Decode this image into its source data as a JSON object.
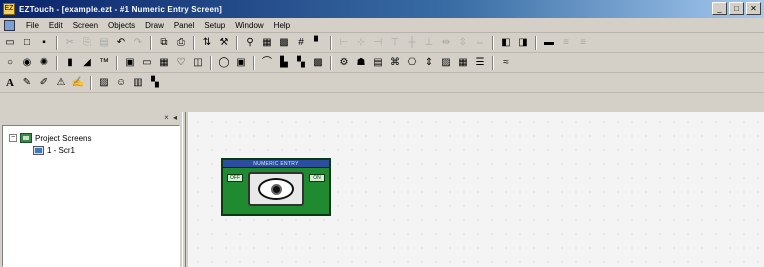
{
  "window": {
    "app_icon_glyph": "EZ",
    "title": "EZTouch - [example.ezt - #1 Numeric Entry Screen]",
    "min_glyph": "_",
    "max_glyph": "□",
    "close_glyph": "✕"
  },
  "menu": {
    "items": [
      "File",
      "Edit",
      "Screen",
      "Objects",
      "Draw",
      "Panel",
      "Setup",
      "Window",
      "Help"
    ]
  },
  "toolbar1": [
    {
      "icon": "new-file-icon",
      "glyph": "▭"
    },
    {
      "icon": "new-doc-icon",
      "glyph": "□"
    },
    {
      "icon": "save-icon",
      "glyph": "▪"
    },
    {
      "sep": true
    },
    {
      "icon": "cut-icon",
      "glyph": "✂",
      "dim": true
    },
    {
      "icon": "copy-icon",
      "glyph": "⎘",
      "dim": true
    },
    {
      "icon": "paste-icon",
      "glyph": "▤",
      "dim": true
    },
    {
      "icon": "undo-icon",
      "glyph": "↶"
    },
    {
      "icon": "redo-icon",
      "glyph": "↷",
      "dim": true
    },
    {
      "sep": true
    },
    {
      "icon": "copy-screen-icon",
      "glyph": "⧉"
    },
    {
      "icon": "print-icon",
      "glyph": "⎙"
    },
    {
      "sep": true
    },
    {
      "icon": "transfer-icon",
      "glyph": "⇅"
    },
    {
      "icon": "tools-icon",
      "glyph": "⚒"
    },
    {
      "sep": true
    },
    {
      "icon": "zoom-icon",
      "glyph": "⚲"
    },
    {
      "icon": "grid-icon",
      "glyph": "▦"
    },
    {
      "icon": "grid-fine-icon",
      "glyph": "▩"
    },
    {
      "icon": "snap-icon",
      "glyph": "#"
    },
    {
      "icon": "flag-icon",
      "glyph": "▘"
    },
    {
      "sep": true
    },
    {
      "icon": "align-left-icon",
      "glyph": "⊢",
      "dim": true
    },
    {
      "icon": "align-center-icon",
      "glyph": "⊹",
      "dim": true
    },
    {
      "icon": "align-right-icon",
      "glyph": "⊣",
      "dim": true
    },
    {
      "icon": "align-top-icon",
      "glyph": "⊤",
      "dim": true
    },
    {
      "icon": "align-middle-icon",
      "glyph": "┼",
      "dim": true
    },
    {
      "icon": "align-bottom-icon",
      "glyph": "⊥",
      "dim": true
    },
    {
      "icon": "space-h-icon",
      "glyph": "⇹",
      "dim": true
    },
    {
      "icon": "space-v-icon",
      "glyph": "⇳",
      "dim": true
    },
    {
      "icon": "same-size-icon",
      "glyph": "⇔",
      "dim": true
    },
    {
      "sep": true
    },
    {
      "icon": "bring-front-icon",
      "glyph": "◧"
    },
    {
      "icon": "send-back-icon",
      "glyph": "◨"
    },
    {
      "sep": true
    },
    {
      "icon": "panel-icon",
      "glyph": "▬"
    },
    {
      "icon": "more1-icon",
      "glyph": "≡",
      "dim": true
    },
    {
      "icon": "more2-icon",
      "glyph": "≡",
      "dim": true
    }
  ],
  "toolbar2": [
    {
      "icon": "circle-icon",
      "glyph": "○"
    },
    {
      "icon": "lamp-icon",
      "glyph": "◉"
    },
    {
      "icon": "pilot-light-icon",
      "glyph": "✺"
    },
    {
      "sep": true
    },
    {
      "icon": "bargraph-icon",
      "glyph": "▮"
    },
    {
      "icon": "meter-icon",
      "glyph": "◢"
    },
    {
      "icon": "tm-icon",
      "glyph": "™"
    },
    {
      "sep": true
    },
    {
      "icon": "numeric-display-icon",
      "glyph": "▣"
    },
    {
      "icon": "numeric-entry-icon",
      "glyph": "▭"
    },
    {
      "icon": "keypad-icon",
      "glyph": "▦"
    },
    {
      "icon": "indicator-icon",
      "glyph": "♡"
    },
    {
      "icon": "selector-icon",
      "glyph": "◫"
    },
    {
      "sep": true
    },
    {
      "icon": "ellipse-button-icon",
      "glyph": "◯"
    },
    {
      "icon": "pushbutton-icon",
      "glyph": "▣"
    },
    {
      "sep": true
    },
    {
      "icon": "arc-icon",
      "glyph": "⌒"
    },
    {
      "icon": "chart-icon",
      "glyph": "▙"
    },
    {
      "icon": "trend-icon",
      "glyph": "▚"
    },
    {
      "icon": "bitmap-icon",
      "glyph": "▩"
    },
    {
      "sep": true
    },
    {
      "icon": "thumbwheel-icon",
      "glyph": "⚙"
    },
    {
      "icon": "alarm-icon",
      "glyph": "☗"
    },
    {
      "icon": "recipe-icon",
      "glyph": "▤"
    },
    {
      "icon": "switch-icon",
      "glyph": "⌘"
    },
    {
      "icon": "goto-screen-icon",
      "glyph": "⎔"
    },
    {
      "icon": "slider-icon",
      "glyph": "⇕"
    },
    {
      "icon": "message-icon",
      "glyph": "▨"
    },
    {
      "icon": "bitmap-button-icon",
      "glyph": "▦"
    },
    {
      "icon": "list-icon",
      "glyph": "☰"
    },
    {
      "sep": true
    },
    {
      "icon": "wave-icon",
      "glyph": "≈"
    }
  ],
  "toolbar3": [
    {
      "icon": "text-a-icon",
      "glyph": "A",
      "bold": true
    },
    {
      "icon": "text-edit-icon",
      "glyph": "✎"
    },
    {
      "icon": "text-style-icon",
      "glyph": "✐"
    },
    {
      "icon": "warning-icon",
      "glyph": "⚠"
    },
    {
      "icon": "signature-icon",
      "glyph": "✍"
    },
    {
      "sep": true
    },
    {
      "icon": "image-icon",
      "glyph": "▨"
    },
    {
      "icon": "people-icon",
      "glyph": "☺"
    },
    {
      "icon": "library-icon",
      "glyph": "▥"
    },
    {
      "icon": "project-icon",
      "glyph": "▚"
    }
  ],
  "tree": {
    "pane_close": "× ◂",
    "root_expander": "−",
    "root_label": "Project Screens",
    "child_label": "1 - Scr1"
  },
  "widget": {
    "title": "NUMERIC ENTRY",
    "left_label": "OFF",
    "right_label": "ON"
  }
}
